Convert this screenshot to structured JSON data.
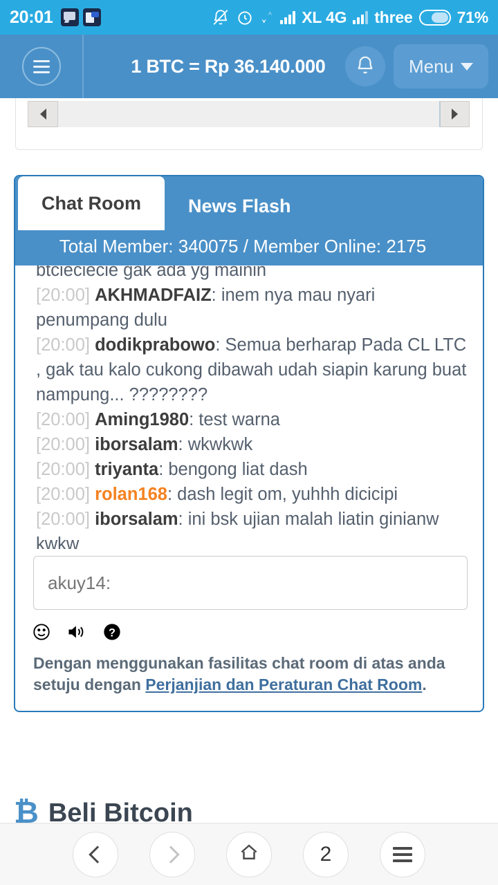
{
  "statusbar": {
    "clock": "20:01",
    "left_icons": [
      "bbm-chat-icon",
      "document-message-icon"
    ],
    "icons": [
      "bell-off-icon",
      "alarm-clock-icon",
      "data-transfer-icon",
      "signal-bars-icon"
    ],
    "carrier_1": "XL 4G",
    "carrier_2": "three",
    "battery_percent": "71%"
  },
  "header": {
    "menu_icon": "hamburger-icon",
    "title": "1 BTC = Rp 36.140.000",
    "bell_icon": "bell-icon",
    "menu_label": "Menu",
    "caret_icon": "chevron-down-icon"
  },
  "topcard": {
    "scroll_left_icon": "arrow-left-icon",
    "scroll_right_icon": "arrow-right-icon"
  },
  "chat": {
    "tabs": [
      {
        "label": "Chat Room",
        "active": true
      },
      {
        "label": "News Flash",
        "active": false
      }
    ],
    "member_bar": "Total Member: 340075 / Member Online: 2175",
    "messages": [
      {
        "ts": "",
        "nick": "",
        "body": "btcieciecie gak ada yg mainin",
        "highlight": false
      },
      {
        "ts": "[20:00]",
        "nick": "AKHMADFAIZ",
        "body": ": inem nya mau nyari penumpang dulu",
        "highlight": false
      },
      {
        "ts": "[20:00]",
        "nick": "dodikprabowo",
        "body": ": Semua berharap Pada CL LTC , gak tau kalo cukong dibawah udah siapin karung buat nampung... ????????",
        "highlight": false
      },
      {
        "ts": "[20:00]",
        "nick": "Aming1980",
        "body": ": test warna",
        "highlight": false
      },
      {
        "ts": "[20:00]",
        "nick": "iborsalam",
        "body": ": wkwkwk",
        "highlight": false
      },
      {
        "ts": "[20:00]",
        "nick": "triyanta",
        "body": ": bengong liat dash",
        "highlight": false
      },
      {
        "ts": "[20:00]",
        "nick": "rolan168",
        "body": ": dash legit om, yuhhh dicicipi",
        "highlight": true
      },
      {
        "ts": "[20:00]",
        "nick": "iborsalam",
        "body": ": ini bsk ujian malah liatin ginianw kwkw",
        "highlight": false
      }
    ],
    "input_value": "akuy14:",
    "input_placeholder": "akuy14:",
    "tool_icons": [
      "smiley-icon",
      "speaker-icon",
      "help-icon"
    ],
    "disclaimer_prefix": "Dengan menggunakan fasilitas chat room di atas anda setuju dengan ",
    "disclaimer_link": "Perjanjian dan Peraturan Chat Room",
    "disclaimer_suffix": "."
  },
  "beli": {
    "logo_icon": "bitcoin-icon",
    "title": "Beli Bitcoin"
  },
  "bottomnav": {
    "back_icon": "chevron-left-icon",
    "forward_icon": "chevron-right-icon",
    "home_icon": "home-icon",
    "tab_count": "2",
    "menu_icon": "hamburger-icon"
  },
  "colors": {
    "status_blue": "#29ABE2",
    "header_blue": "#4A90C8",
    "card_border": "#2a7ab9",
    "highlight_nick": "#f58220",
    "link": "#3f6f9e"
  }
}
